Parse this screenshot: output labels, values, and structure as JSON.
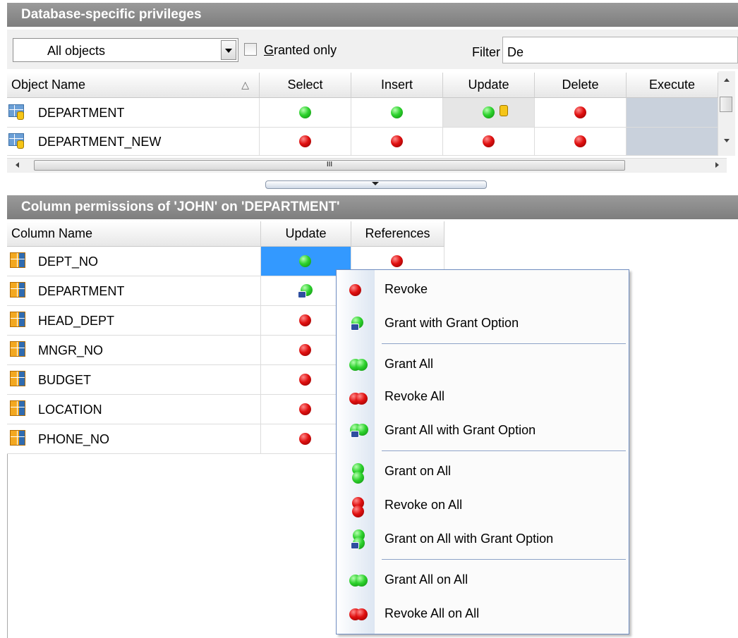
{
  "top_panel": {
    "title": "Database-specific privileges",
    "object_filter_value": "All objects",
    "granted_only_label": "Granted only",
    "filter_label": "Filter",
    "filter_value": "De",
    "columns": [
      "Object Name",
      "Select",
      "Insert",
      "Update",
      "Delete",
      "Execute"
    ],
    "rows": [
      {
        "name": "DEPARTMENT",
        "select": "granted",
        "insert": "granted",
        "update": "granted",
        "delete": "revoked",
        "execute": "n/a"
      },
      {
        "name": "DEPARTMENT_NEW",
        "select": "revoked",
        "insert": "revoked",
        "update": "revoked",
        "delete": "revoked",
        "execute": "n/a"
      }
    ],
    "scroll_grip": "III"
  },
  "bottom_panel": {
    "title": "Column permissions of 'JOHN' on 'DEPARTMENT'",
    "columns": [
      "Column Name",
      "Update",
      "References"
    ],
    "rows": [
      {
        "name": "DEPT_NO",
        "update": "granted",
        "references": "revoked"
      },
      {
        "name": "DEPARTMENT",
        "update": "grant_option"
      },
      {
        "name": "HEAD_DEPT",
        "update": "revoked"
      },
      {
        "name": "MNGR_NO",
        "update": "revoked"
      },
      {
        "name": "BUDGET",
        "update": "revoked"
      },
      {
        "name": "LOCATION",
        "update": "revoked"
      },
      {
        "name": "PHONE_NO",
        "update": "revoked"
      }
    ]
  },
  "context_menu": {
    "items": [
      {
        "label": "Revoke",
        "icon": "red-dot-icon"
      },
      {
        "label": "Grant with Grant Option",
        "icon": "green-dot-hand-icon"
      },
      {
        "label": "Grant All",
        "icon": "double-green-dot-icon"
      },
      {
        "label": "Revoke All",
        "icon": "double-red-dot-icon"
      },
      {
        "label": "Grant All with Grant Option",
        "icon": "double-green-dot-hand-icon"
      },
      {
        "label": "Grant on All",
        "icon": "stacked-green-dot-icon"
      },
      {
        "label": "Revoke on All",
        "icon": "stacked-red-dot-icon"
      },
      {
        "label": "Grant on All with Grant Option",
        "icon": "stacked-green-dot-hand-icon"
      },
      {
        "label": "Grant All on All",
        "icon": "double-green-dot-icon"
      },
      {
        "label": "Revoke All on All",
        "icon": "double-red-dot-icon"
      }
    ]
  },
  "colors": {
    "header_bg": "#8a8a8a",
    "selection": "#3399ff",
    "granted": "#22c022",
    "revoked": "#e01010",
    "menu_border": "#6f8cc0"
  }
}
